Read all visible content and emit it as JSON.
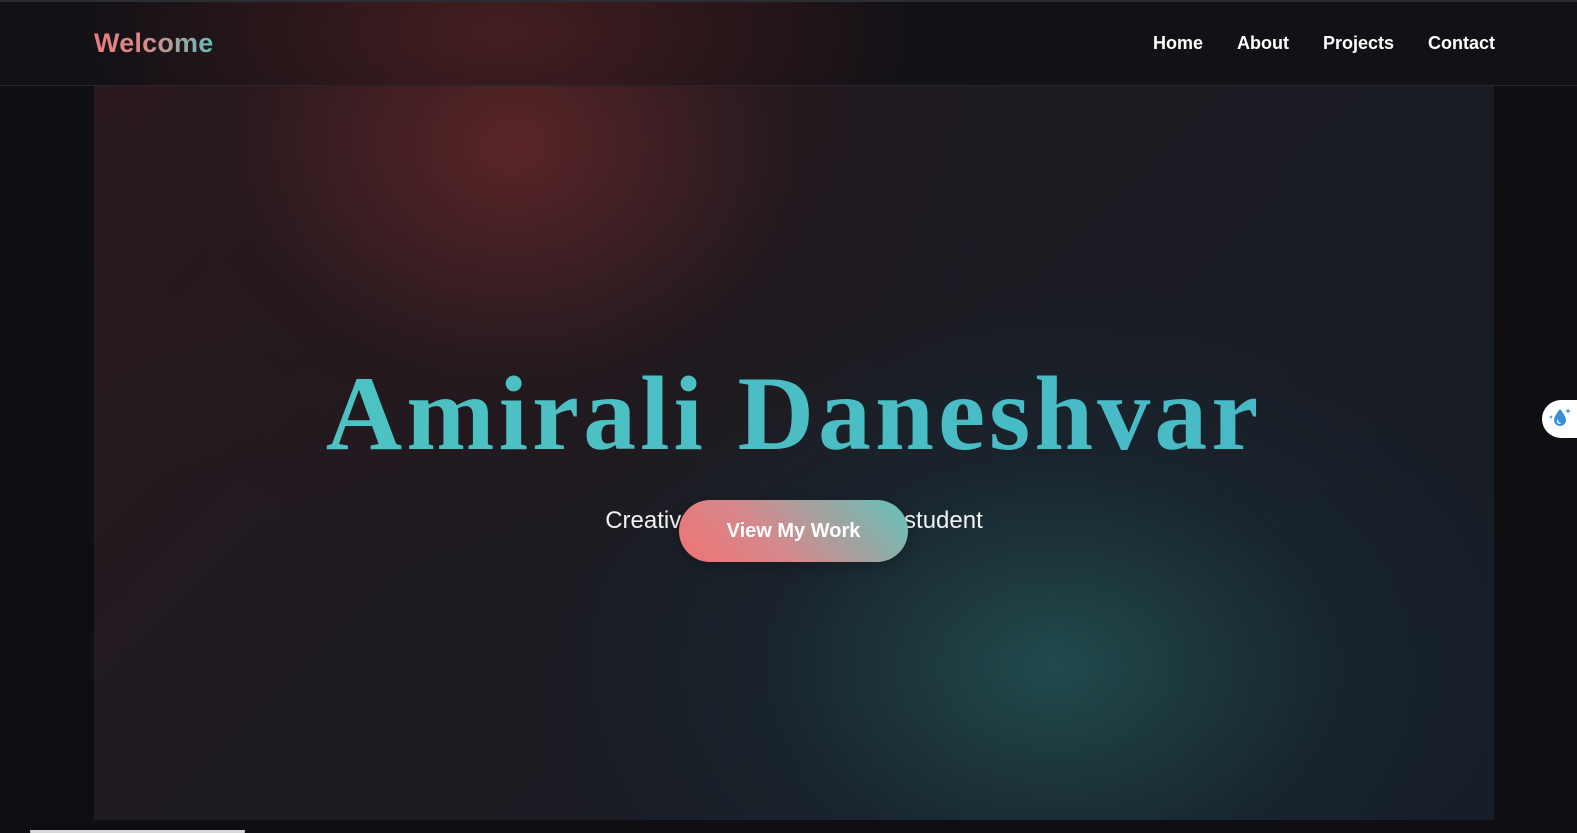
{
  "header": {
    "logo": "Welcome",
    "nav": [
      {
        "label": "Home"
      },
      {
        "label": "About"
      },
      {
        "label": "Projects"
      },
      {
        "label": "Contact"
      }
    ]
  },
  "hero": {
    "title": "Amirali Daneshvar",
    "subtitle": "Creative Developer and CE student",
    "cta_label": "View My Work"
  },
  "widget": {
    "icon": "water-drop-sparkle-icon"
  },
  "colors": {
    "accent_coral": "#f07374",
    "accent_teal": "#49c0c4",
    "background": "#0f0f13"
  }
}
